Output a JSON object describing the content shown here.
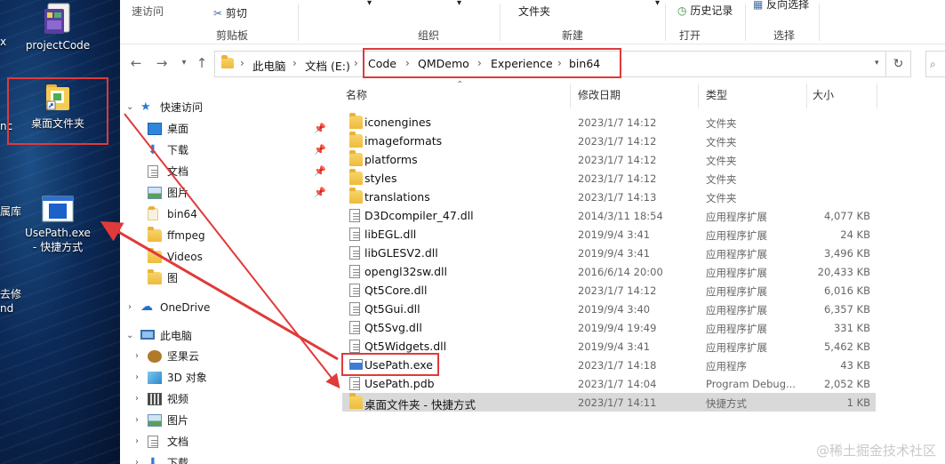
{
  "desktop": {
    "icons": [
      {
        "label": "projectCode",
        "icon": "project-code-icon"
      },
      {
        "label": "桌面文件夹",
        "icon": "folder-shortcut-icon"
      },
      {
        "label": "UsePath.exe\n- 快捷方式",
        "icon": "exe-shortcut-icon"
      }
    ],
    "edge_labels": [
      "x",
      "nc",
      "属库",
      "去修",
      "nd"
    ]
  },
  "ribbon": {
    "quick_access": "速访问",
    "cut": "剪切",
    "clipboard": "剪贴板",
    "organize": "组织",
    "new_folder": "文件夹",
    "new_group": "新建",
    "history": "历史记录",
    "open_group": "打开",
    "invert_selection": "反向选择",
    "select_group": "选择"
  },
  "address": {
    "segments": [
      "此电脑",
      "文档 (E:)",
      "Code",
      "QMDemo",
      "Experience",
      "bin64"
    ]
  },
  "navpane": {
    "quick_access": "快速访问",
    "quick_items": [
      "桌面",
      "下载",
      "文档",
      "图片",
      "bin64",
      "ffmpeg",
      "Videos",
      "图"
    ],
    "onedrive": "OneDrive",
    "this_pc": "此电脑",
    "pc_items": [
      "坚果云",
      "3D 对象",
      "视频",
      "图片",
      "文档",
      "下载"
    ]
  },
  "columns": {
    "name": "名称",
    "date": "修改日期",
    "type": "类型",
    "size": "大小"
  },
  "files": [
    {
      "name": "iconengines",
      "date": "2023/1/7 14:12",
      "type": "文件夹",
      "size": "",
      "kind": "folder"
    },
    {
      "name": "imageformats",
      "date": "2023/1/7 14:12",
      "type": "文件夹",
      "size": "",
      "kind": "folder"
    },
    {
      "name": "platforms",
      "date": "2023/1/7 14:12",
      "type": "文件夹",
      "size": "",
      "kind": "folder"
    },
    {
      "name": "styles",
      "date": "2023/1/7 14:12",
      "type": "文件夹",
      "size": "",
      "kind": "folder"
    },
    {
      "name": "translations",
      "date": "2023/1/7 14:13",
      "type": "文件夹",
      "size": "",
      "kind": "folder"
    },
    {
      "name": "D3Dcompiler_47.dll",
      "date": "2014/3/11 18:54",
      "type": "应用程序扩展",
      "size": "4,077 KB",
      "kind": "dll"
    },
    {
      "name": "libEGL.dll",
      "date": "2019/9/4 3:41",
      "type": "应用程序扩展",
      "size": "24 KB",
      "kind": "dll"
    },
    {
      "name": "libGLESV2.dll",
      "date": "2019/9/4 3:41",
      "type": "应用程序扩展",
      "size": "3,496 KB",
      "kind": "dll"
    },
    {
      "name": "opengl32sw.dll",
      "date": "2016/6/14 20:00",
      "type": "应用程序扩展",
      "size": "20,433 KB",
      "kind": "dll"
    },
    {
      "name": "Qt5Core.dll",
      "date": "2023/1/7 14:12",
      "type": "应用程序扩展",
      "size": "6,016 KB",
      "kind": "dll"
    },
    {
      "name": "Qt5Gui.dll",
      "date": "2019/9/4 3:40",
      "type": "应用程序扩展",
      "size": "6,357 KB",
      "kind": "dll"
    },
    {
      "name": "Qt5Svg.dll",
      "date": "2019/9/4 19:49",
      "type": "应用程序扩展",
      "size": "331 KB",
      "kind": "dll"
    },
    {
      "name": "Qt5Widgets.dll",
      "date": "2019/9/4 3:41",
      "type": "应用程序扩展",
      "size": "5,462 KB",
      "kind": "dll"
    },
    {
      "name": "UsePath.exe",
      "date": "2023/1/7 14:18",
      "type": "应用程序",
      "size": "43 KB",
      "kind": "exe"
    },
    {
      "name": "UsePath.pdb",
      "date": "2023/1/7 14:04",
      "type": "Program Debug...",
      "size": "2,052 KB",
      "kind": "pdb"
    },
    {
      "name": "桌面文件夹 - 快捷方式",
      "date": "2023/1/7 14:11",
      "type": "快捷方式",
      "size": "1 KB",
      "kind": "shortcut"
    }
  ],
  "watermark": "@稀土掘金技术社区",
  "colors": {
    "highlight": "#e03a3a",
    "selection": "#d9d9d9",
    "accent": "#0067c0"
  }
}
